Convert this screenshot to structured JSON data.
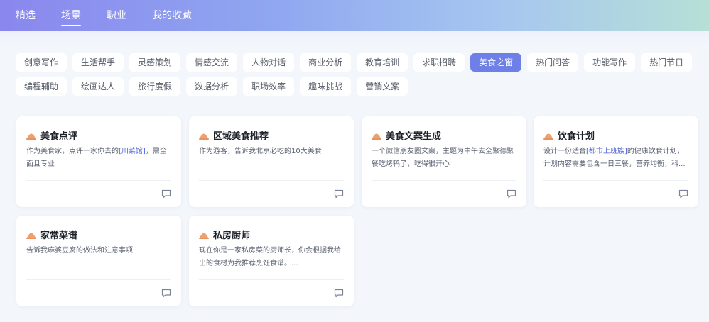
{
  "nav": {
    "tabs": [
      {
        "label": "精选",
        "active": false
      },
      {
        "label": "场景",
        "active": true
      },
      {
        "label": "职业",
        "active": false
      },
      {
        "label": "我的收藏",
        "active": false
      }
    ]
  },
  "tags": {
    "row1": [
      "创意写作",
      "生活帮手",
      "灵感策划",
      "情感交流",
      "人物对话",
      "商业分析",
      "教育培训",
      "求职招聘",
      "美食之窗",
      "热门问答",
      "功能写作",
      "热门节日"
    ],
    "row2": [
      "编程辅助",
      "绘画达人",
      "旅行度假",
      "数据分析",
      "职场效率",
      "趣味挑战",
      "营销文案"
    ],
    "selected": "美食之窗"
  },
  "cards": [
    {
      "title": "美食点评",
      "desc_parts": [
        "作为美食家，点评一家你去的",
        "[川菜馆]",
        "，需全面且专业"
      ]
    },
    {
      "title": "区域美食推荐",
      "desc_parts": [
        "作为游客，告诉我北京必吃的10大美食"
      ]
    },
    {
      "title": "美食文案生成",
      "desc_parts": [
        "一个微信朋友圈文案，主题为中午去全聚德聚餐吃烤鸭了，吃得很开心"
      ]
    },
    {
      "title": "饮食计划",
      "desc_parts": [
        "设计一份适合",
        "[都市上班族]",
        "的健康饮食计划，计划内容需要包含一日三餐，营养均衡，科..."
      ]
    },
    {
      "title": "家常菜谱",
      "desc_parts": [
        "告诉我麻婆豆腐的做法和注意事项"
      ]
    },
    {
      "title": "私房厨师",
      "desc_parts": [
        "现在你是一家私房菜的厨师长，你会根据我给出的食材为我推荐烹饪食谱。..."
      ]
    }
  ],
  "colors": {
    "accent": "#6f7fe8",
    "highlight": "#4e63d6",
    "icon": "#f0a070"
  },
  "icons": {
    "card": "hat-icon",
    "action": "chat-icon"
  }
}
